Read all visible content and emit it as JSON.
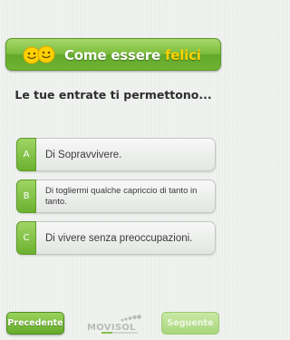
{
  "header": {
    "title_part1": "Come essere ",
    "title_part2": "felici",
    "title_highlight_color": "#ffd200",
    "icon": "smiley-faces-icon"
  },
  "question": "Le tue entrate ti permettono...",
  "answers": [
    {
      "letter": "A",
      "text": "Di Sopravvivere."
    },
    {
      "letter": "B",
      "text": "Di togliermi qualche capriccio di tanto in tanto."
    },
    {
      "letter": "C",
      "text": "Di vivere senza preoccupazioni."
    }
  ],
  "footer": {
    "prev_label": "Precedente",
    "next_label": "Seguente",
    "logo_text": "MOVISOL",
    "progress": 0.3
  },
  "colors": {
    "accent_green": "#6fb433",
    "disabled_green": "#b7dd8e",
    "background": "#ecefec"
  }
}
